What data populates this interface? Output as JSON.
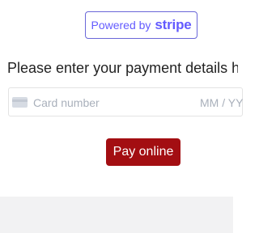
{
  "badge": {
    "powered_text": "Powered by",
    "brand_text": "stripe"
  },
  "prompt": {
    "text": "Please enter your payment details here:"
  },
  "card": {
    "icon": "credit-card-icon",
    "number_placeholder": "Card number",
    "expiry_placeholder": "MM / YY"
  },
  "actions": {
    "pay_label": "Pay online"
  },
  "colors": {
    "stripe_accent": "#635bff",
    "pay_button": "#a30e12"
  }
}
